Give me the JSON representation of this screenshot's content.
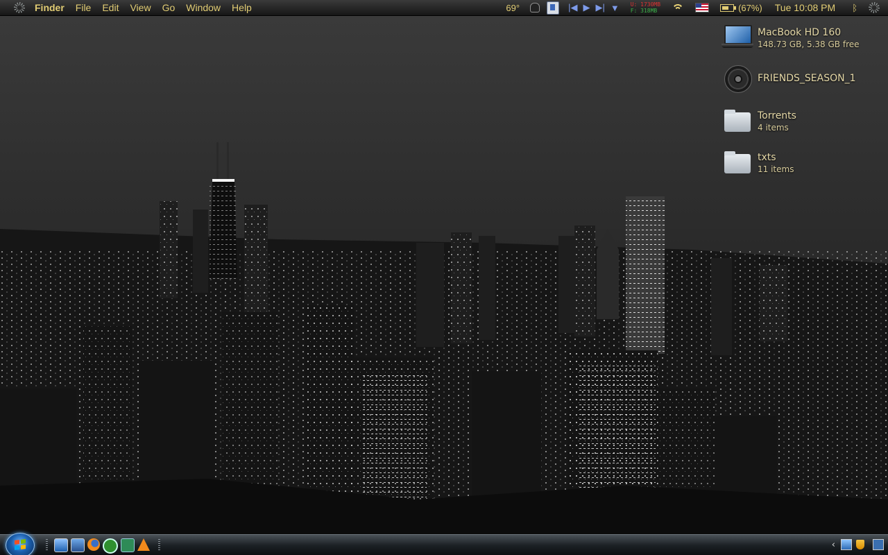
{
  "menubar": {
    "app_name": "Finder",
    "menus": [
      "File",
      "Edit",
      "View",
      "Go",
      "Window",
      "Help"
    ],
    "temperature": "69°",
    "memory_used": "U: 1730MB",
    "memory_free": "F:  318MB",
    "media_controls": [
      "|◀",
      "▶",
      "▶|",
      "▼"
    ],
    "battery": "(67%)",
    "clock": "Tue 10:08 PM",
    "bluetooth_glyph": "ᛒ"
  },
  "desktop_items": [
    {
      "name": "MacBook HD 160",
      "sub": "148.73 GB, 5.38 GB free",
      "icon": "laptop-icon"
    },
    {
      "name": "FRIENDS_SEASON_1",
      "sub": "",
      "icon": "disc-icon"
    },
    {
      "name": "Torrents",
      "sub": "4 items",
      "icon": "folder-icon"
    },
    {
      "name": "txts",
      "sub": "11 items",
      "icon": "folder-icon"
    }
  ],
  "taskbar": {
    "quick_launch": [
      "show-desktop-icon",
      "explorer-icon",
      "firefox-icon",
      "utorrent-icon",
      "calculator-icon",
      "vlc-icon"
    ],
    "tray_chevron": "‹"
  },
  "colors": {
    "menubar_text": "#e2cd74",
    "desktop_label": "#e6d9a8"
  }
}
